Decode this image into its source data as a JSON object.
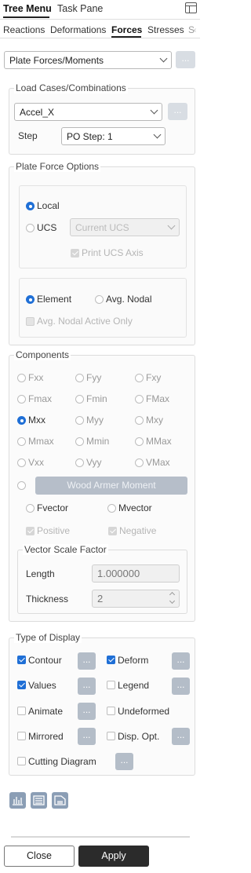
{
  "top_tabs": [
    "Tree Menu",
    "Task Pane"
  ],
  "sub_tabs": [
    "Reactions",
    "Deformations",
    "Forces",
    "Stresses",
    "S"
  ],
  "result_type": "Plate Forces/Moments",
  "dots": "...",
  "load": {
    "title": "Load Cases/Combinations",
    "case": "Accel_X",
    "step_label": "Step",
    "step_value": "PO Step: 1"
  },
  "plate_force": {
    "title": "Plate Force Options",
    "local": "Local",
    "ucs": "UCS",
    "ucs_combo": "Current UCS",
    "print_ucs": "Print UCS Axis",
    "element": "Element",
    "avg_nodal": "Avg. Nodal",
    "avg_nodal_active": "Avg. Nodal Active Only"
  },
  "components": {
    "title": "Components",
    "rows": [
      [
        "Fxx",
        "Fyy",
        "Fxy"
      ],
      [
        "Fmax",
        "Fmin",
        "FMax"
      ],
      [
        "Mxx",
        "Myy",
        "Mxy"
      ],
      [
        "Mmax",
        "Mmin",
        "MMax"
      ],
      [
        "Vxx",
        "Vyy",
        "VMax"
      ]
    ],
    "selected": "Mxx",
    "wood_armer": "Wood Armer Moment",
    "fvector": "Fvector",
    "mvector": "Mvector",
    "positive": "Positive",
    "negative": "Negative",
    "vsf_title": "Vector Scale Factor",
    "length_label": "Length",
    "length_value": "1.000000",
    "thickness_label": "Thickness",
    "thickness_value": "2"
  },
  "display": {
    "title": "Type of Display",
    "contour": "Contour",
    "deform": "Deform",
    "values": "Values",
    "legend": "Legend",
    "animate": "Animate",
    "undeformed": "Undeformed",
    "mirrored": "Mirrored",
    "disp_opt": "Disp. Opt.",
    "cutting": "Cutting Diagram"
  },
  "footer": {
    "close": "Close",
    "apply": "Apply"
  },
  "colors": {
    "accent": "#1f6fd6",
    "apply_bg": "#2b2b2b",
    "dots_bg": "#b4bdc8",
    "icon_bg": "#8b9eb5"
  }
}
